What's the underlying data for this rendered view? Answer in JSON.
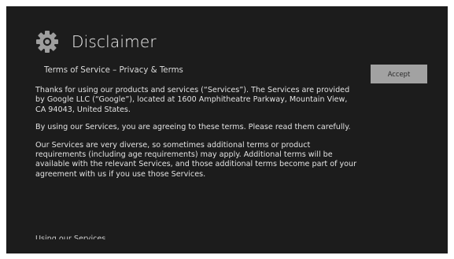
{
  "header": {
    "title": "Disclaimer",
    "icon": "gear-icon"
  },
  "subtitle": "Terms of Service – Privacy & Terms",
  "paragraphs": [
    "Thanks for using our products and services (“Services”). The Services are provided by Google LLC (“Google”), located at 1600 Amphitheatre Parkway, Mountain View, CA 94043, United States.",
    "By using our Services, you are agreeing to these terms. Please read them carefully.",
    "Our Services are very diverse, so sometimes additional terms or product requirements (including age requirements) may apply. Additional terms will be available with the relevant Services, and those additional terms become part of your agreement with us if you use those Services."
  ],
  "cut_off_heading": "Using our Services",
  "accept_button": {
    "label": "Accept"
  },
  "colors": {
    "background": "#1c1c1c",
    "button": "#a2a2a2",
    "text": "#e2e2e2"
  }
}
